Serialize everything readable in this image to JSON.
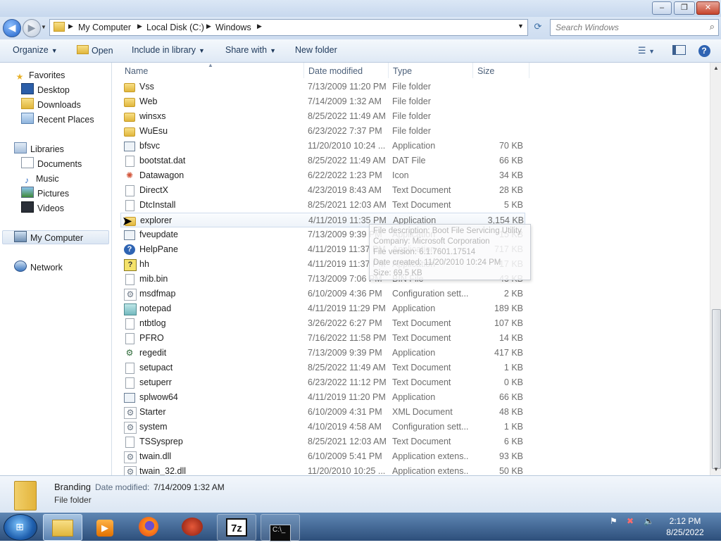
{
  "window": {
    "minimize": "–",
    "maximize": "❐",
    "close": "✕"
  },
  "address": {
    "breadcrumbs": [
      "My Computer",
      "Local Disk (C:)",
      "Windows"
    ],
    "search_placeholder": "Search Windows"
  },
  "toolbar": {
    "organize": "Organize",
    "open": "Open",
    "include_in_library": "Include in library",
    "share_with": "Share with",
    "new_folder": "New folder"
  },
  "nav": {
    "favorites": "Favorites",
    "desktop": "Desktop",
    "downloads": "Downloads",
    "recent_places": "Recent Places",
    "libraries": "Libraries",
    "documents": "Documents",
    "music": "Music",
    "pictures": "Pictures",
    "videos": "Videos",
    "my_computer": "My Computer",
    "network": "Network"
  },
  "columns": {
    "name": "Name",
    "date_modified": "Date modified",
    "type": "Type",
    "size": "Size"
  },
  "files": [
    {
      "name": "Vss",
      "date": "7/13/2009 11:20 PM",
      "type": "File folder",
      "size": "",
      "icon": "folder"
    },
    {
      "name": "Web",
      "date": "7/14/2009 1:32 AM",
      "type": "File folder",
      "size": "",
      "icon": "folder"
    },
    {
      "name": "winsxs",
      "date": "8/25/2022 11:49 AM",
      "type": "File folder",
      "size": "",
      "icon": "folder"
    },
    {
      "name": "WuEsu",
      "date": "6/23/2022 7:37 PM",
      "type": "File folder",
      "size": "",
      "icon": "folder"
    },
    {
      "name": "bfsvc",
      "date": "11/20/2010 10:24 ...",
      "type": "Application",
      "size": "70 KB",
      "icon": "app"
    },
    {
      "name": "bootstat.dat",
      "date": "8/25/2022 11:49 AM",
      "type": "DAT File",
      "size": "66 KB",
      "icon": "doc"
    },
    {
      "name": "Datawagon",
      "date": "6/22/2022 1:23 PM",
      "type": "Icon",
      "size": "34 KB",
      "icon": "icon-file"
    },
    {
      "name": "DirectX",
      "date": "4/23/2019 8:43 AM",
      "type": "Text Document",
      "size": "28 KB",
      "icon": "doc"
    },
    {
      "name": "DtcInstall",
      "date": "8/25/2021 12:03 AM",
      "type": "Text Document",
      "size": "5 KB",
      "icon": "doc"
    },
    {
      "name": "explorer",
      "date": "4/11/2019 11:35 PM",
      "type": "Application",
      "size": "3,154 KB",
      "icon": "folder"
    },
    {
      "name": "fveupdate",
      "date": "7/13/2009 9:39 PM",
      "type": "Application",
      "size": "15 KB",
      "icon": "app"
    },
    {
      "name": "HelpPane",
      "date": "4/11/2019 11:37 PM",
      "type": "Application",
      "size": "717 KB",
      "icon": "help"
    },
    {
      "name": "hh",
      "date": "4/11/2019 11:37 PM",
      "type": "Application",
      "size": "17 KB",
      "icon": "hh"
    },
    {
      "name": "mib.bin",
      "date": "7/13/2009 7:06 PM",
      "type": "BIN File",
      "size": "43 KB",
      "icon": "doc"
    },
    {
      "name": "msdfmap",
      "date": "6/10/2009 4:36 PM",
      "type": "Configuration sett...",
      "size": "2 KB",
      "icon": "config"
    },
    {
      "name": "notepad",
      "date": "4/11/2019 11:29 PM",
      "type": "Application",
      "size": "189 KB",
      "icon": "notepad"
    },
    {
      "name": "ntbtlog",
      "date": "3/26/2022 6:27 PM",
      "type": "Text Document",
      "size": "107 KB",
      "icon": "doc"
    },
    {
      "name": "PFRO",
      "date": "7/16/2022 11:58 PM",
      "type": "Text Document",
      "size": "14 KB",
      "icon": "doc"
    },
    {
      "name": "regedit",
      "date": "7/13/2009 9:39 PM",
      "type": "Application",
      "size": "417 KB",
      "icon": "regedit"
    },
    {
      "name": "setupact",
      "date": "8/25/2022 11:49 AM",
      "type": "Text Document",
      "size": "1 KB",
      "icon": "doc"
    },
    {
      "name": "setuperr",
      "date": "6/23/2022 11:12 PM",
      "type": "Text Document",
      "size": "0 KB",
      "icon": "doc"
    },
    {
      "name": "splwow64",
      "date": "4/11/2019 11:20 PM",
      "type": "Application",
      "size": "66 KB",
      "icon": "app"
    },
    {
      "name": "Starter",
      "date": "6/10/2009 4:31 PM",
      "type": "XML Document",
      "size": "48 KB",
      "icon": "config"
    },
    {
      "name": "system",
      "date": "4/10/2019 4:58 AM",
      "type": "Configuration sett...",
      "size": "1 KB",
      "icon": "config"
    },
    {
      "name": "TSSysprep",
      "date": "8/25/2021 12:03 AM",
      "type": "Text Document",
      "size": "6 KB",
      "icon": "doc"
    },
    {
      "name": "twain.dll",
      "date": "6/10/2009 5:41 PM",
      "type": "Application extens...",
      "size": "93 KB",
      "icon": "config"
    },
    {
      "name": "twain_32.dll",
      "date": "11/20/2010 10:25 ...",
      "type": "Application extens...",
      "size": "50 KB",
      "icon": "config"
    }
  ],
  "tooltip": {
    "lines": [
      "File description: Boot File Servicing Utility",
      "Company: Microsoft Corporation",
      "File version: 6.1.7601.17514",
      "Date created: 11/20/2010 10:24 PM",
      "Size: 69.5 KB"
    ]
  },
  "details": {
    "name": "Branding",
    "date_label": "Date modified:",
    "date_value": "7/14/2009 1:32 AM",
    "type": "File folder"
  },
  "taskbar": {
    "clock_time": "2:12 PM",
    "clock_date": "8/25/2022",
    "seven_zip": "7z"
  }
}
